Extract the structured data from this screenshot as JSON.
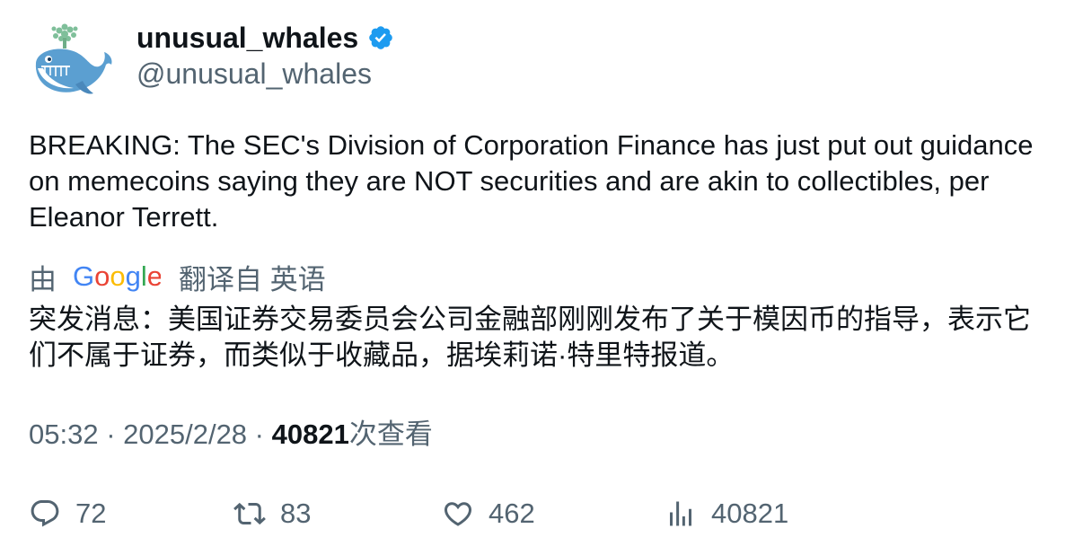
{
  "author": {
    "display_name": "unusual_whales",
    "handle": "@unusual_whales",
    "verified": true,
    "avatar_icon": "whale-logo-icon",
    "verified_color": "#1d9bf0"
  },
  "tweet": {
    "text": "BREAKING: The SEC's Division of Corporation Finance has just put out guidance on memecoins saying they are NOT securities and are akin to collectibles, per Eleanor Terrett."
  },
  "translation": {
    "by_label": "由",
    "provider": "Google",
    "from_label": "翻译自 英语",
    "text": "突发消息：美国证券交易委员会公司金融部刚刚发布了关于模因币的指导，表示它们不属于证券，而类似于收藏品，据埃莉诺·特里特报道。"
  },
  "meta": {
    "time": "05:32",
    "separator1": " · ",
    "date": "2025/2/28",
    "separator2": " · ",
    "views_count": "40821",
    "views_label": "次查看"
  },
  "actions": {
    "replies": "72",
    "retweets": "83",
    "likes": "462",
    "views": "40821"
  },
  "colors": {
    "text_primary": "#0f1419",
    "text_secondary": "#536471",
    "accent": "#1d9bf0"
  }
}
